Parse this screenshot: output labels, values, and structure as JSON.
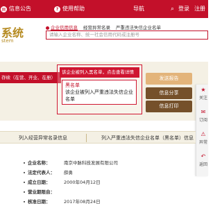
{
  "topbar": {
    "notice_label": "信息公告",
    "help_label": "使用帮助",
    "nav_label": "导航",
    "login_label": "登录",
    "register_label": "注册"
  },
  "logo": {
    "title_fragment": "系统",
    "subtitle_fragment": "stem"
  },
  "search": {
    "tabs": [
      "企业信用信息",
      "经营异常名录",
      "严重违法失信企业名单"
    ],
    "placeholder": "请输入企业名称、统一社会信用代码或注册号"
  },
  "status_stripe": "存续（在营、开业、在册）",
  "callout": {
    "header": "该企业被列入黑名单，点击查看详情",
    "title": "黑名单",
    "text": "该企业被列入严重违法失信企业名单"
  },
  "actions": {
    "send_report": "发送报告",
    "share": "信息分享",
    "print": "信息打印"
  },
  "sidebar": {
    "follow": "关注",
    "subscribe": "订阅",
    "abnormal": "异常",
    "back": "返回"
  },
  "tabs": {
    "abnormal_list": "列入经营异常名录信息",
    "blacklist": "列入严重违法失信企业名单（黑名单）信息"
  },
  "company": {
    "rows": [
      {
        "label": "企业名称：",
        "value": "南京中脉科技发展有限公司"
      },
      {
        "label": "法定代表人：",
        "value": "薛勇"
      },
      {
        "label": "成立日期：",
        "value": "2000年04月12日"
      },
      {
        "label": "营业期限自：",
        "value": ""
      },
      {
        "label": "核准日期：",
        "value": "2017年08月24日"
      }
    ]
  },
  "colors": {
    "brand_red": "#c3102a",
    "gold": "#b58a20",
    "band": "#f4f0e4",
    "btn_light": "#e3b47a",
    "btn_dark": "#75502a"
  }
}
